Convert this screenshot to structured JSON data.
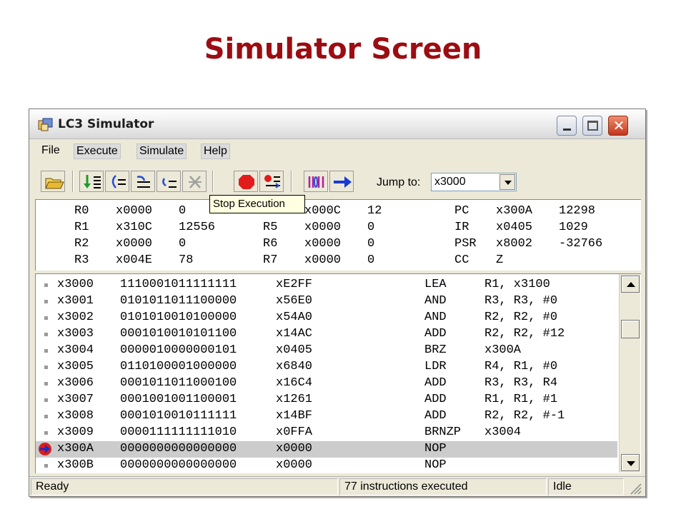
{
  "slide": {
    "title": "Simulator Screen"
  },
  "window": {
    "title": "LC3 Simulator",
    "close_glyph": "✕"
  },
  "menu": [
    "File",
    "Execute",
    "Simulate",
    "Help"
  ],
  "toolbar": {
    "icons": [
      "open-folder-icon",
      "step-into-icon",
      "step-over-icon",
      "step-out-icon",
      "run-to-icon",
      "breakpoint-clear-icon",
      "stop-icon",
      "reset-icon",
      "memory-icon",
      "jump-arrow-icon"
    ],
    "jump_label": "Jump to:",
    "jump_value": "x3000"
  },
  "tooltip": "Stop Execution",
  "registers": [
    [
      {
        "name": "R0",
        "hex": "x0000",
        "dec": "0"
      },
      {
        "name": "R4",
        "hex": "x000C",
        "dec": "12"
      },
      {
        "name": "PC",
        "hex": "x300A",
        "dec": "12298"
      }
    ],
    [
      {
        "name": "R1",
        "hex": "x310C",
        "dec": "12556"
      },
      {
        "name": "R5",
        "hex": "x0000",
        "dec": "0"
      },
      {
        "name": "IR",
        "hex": "x0405",
        "dec": "1029"
      }
    ],
    [
      {
        "name": "R2",
        "hex": "x0000",
        "dec": "0"
      },
      {
        "name": "R6",
        "hex": "x0000",
        "dec": "0"
      },
      {
        "name": "PSR",
        "hex": "x8002",
        "dec": "-32766"
      }
    ],
    [
      {
        "name": "R3",
        "hex": "x004E",
        "dec": "78"
      },
      {
        "name": "R7",
        "hex": "x0000",
        "dec": "0"
      },
      {
        "name": "CC",
        "hex": "Z",
        "dec": ""
      }
    ]
  ],
  "memory": [
    {
      "addr": "x3000",
      "bin": "1110001011111111",
      "hex": "xE2FF",
      "op": "LEA",
      "args": "R1, x3100"
    },
    {
      "addr": "x3001",
      "bin": "0101011011100000",
      "hex": "x56E0",
      "op": "AND",
      "args": "R3, R3, #0"
    },
    {
      "addr": "x3002",
      "bin": "0101010010100000",
      "hex": "x54A0",
      "op": "AND",
      "args": "R2, R2, #0"
    },
    {
      "addr": "x3003",
      "bin": "0001010010101100",
      "hex": "x14AC",
      "op": "ADD",
      "args": "R2, R2, #12"
    },
    {
      "addr": "x3004",
      "bin": "0000010000000101",
      "hex": "x0405",
      "op": "BRZ",
      "args": "x300A"
    },
    {
      "addr": "x3005",
      "bin": "0110100001000000",
      "hex": "x6840",
      "op": "LDR",
      "args": "R4, R1, #0"
    },
    {
      "addr": "x3006",
      "bin": "0001011011000100",
      "hex": "x16C4",
      "op": "ADD",
      "args": "R3, R3, R4"
    },
    {
      "addr": "x3007",
      "bin": "0001001001100001",
      "hex": "x1261",
      "op": "ADD",
      "args": "R1, R1, #1"
    },
    {
      "addr": "x3008",
      "bin": "0001010010111111",
      "hex": "x14BF",
      "op": "ADD",
      "args": "R2, R2, #-1"
    },
    {
      "addr": "x3009",
      "bin": "0000111111111010",
      "hex": "x0FFA",
      "op": "BRNZP",
      "args": "x3004"
    },
    {
      "addr": "x300A",
      "bin": "0000000000000000",
      "hex": "x0000",
      "op": "NOP",
      "args": "",
      "current": true
    },
    {
      "addr": "x300B",
      "bin": "0000000000000000",
      "hex": "x0000",
      "op": "NOP",
      "args": ""
    }
  ],
  "status": {
    "left": "Ready",
    "middle": "77 instructions executed",
    "right": "Idle"
  },
  "colors": {
    "title_red": "#9b0d12",
    "selected_row": "#cccccc",
    "pc_marker_red": "#d81e1e",
    "pc_marker_blue": "#1a2cc8"
  }
}
